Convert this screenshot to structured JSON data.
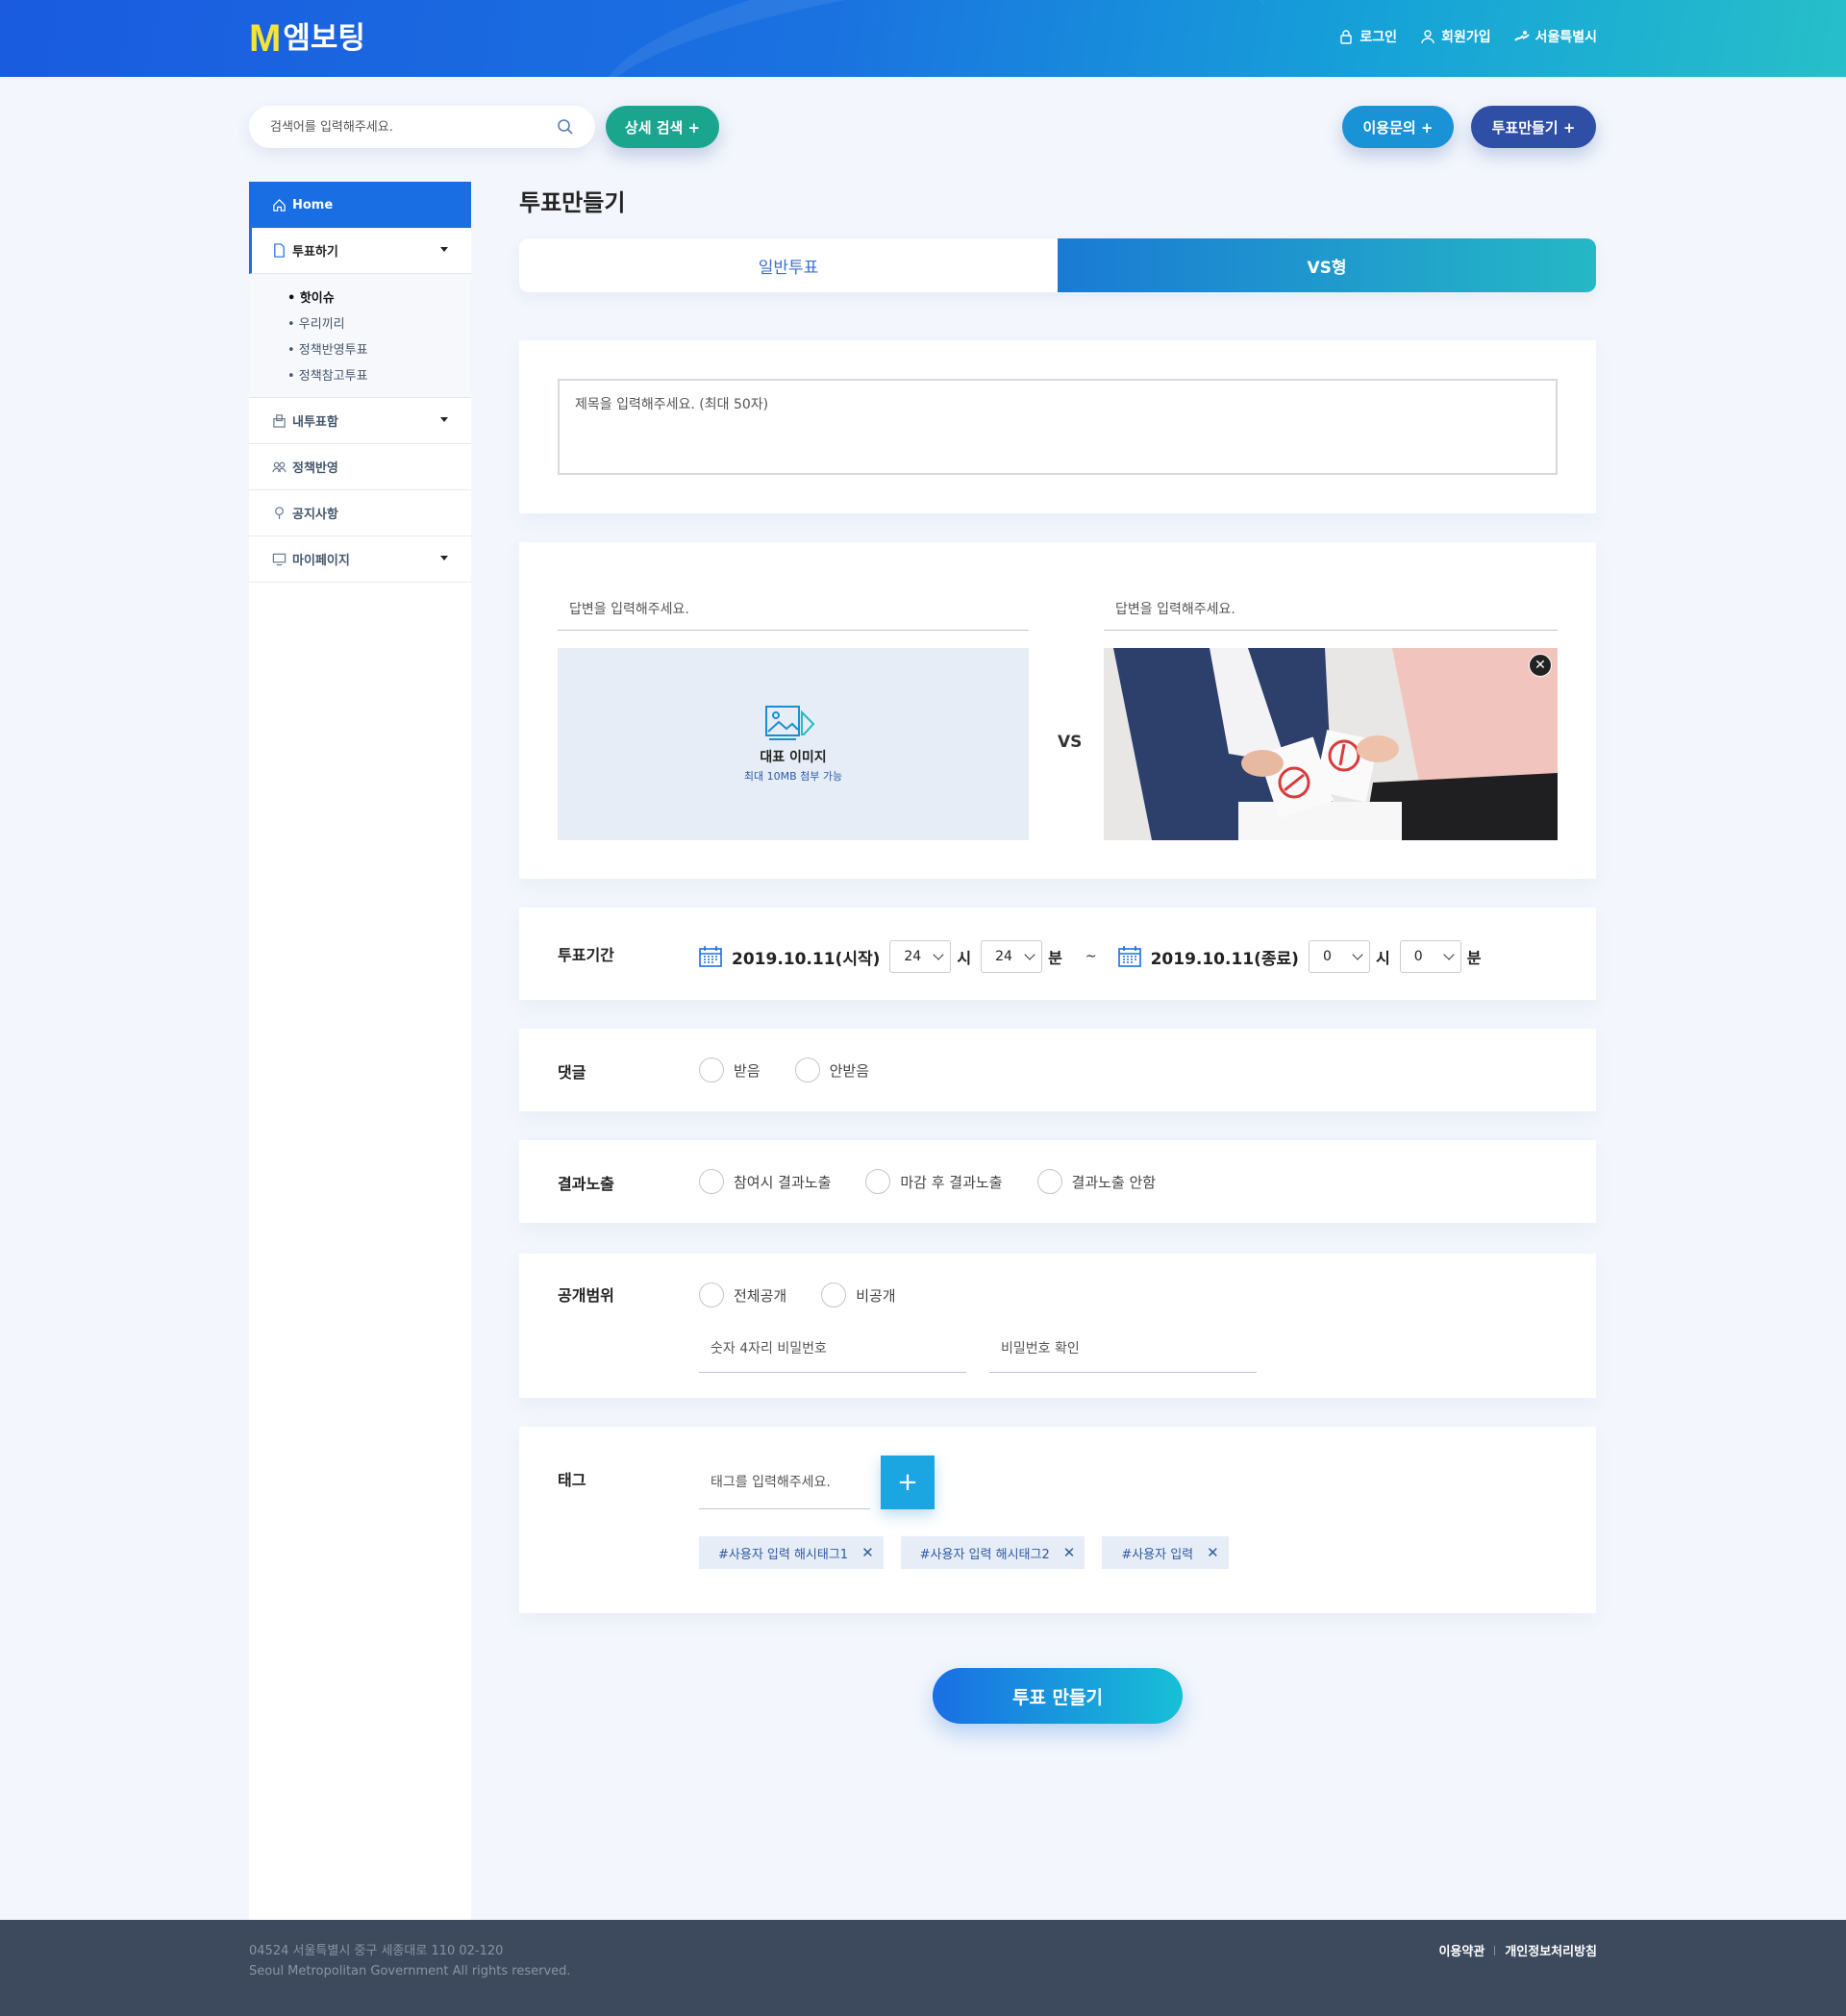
{
  "header": {
    "logo_mark": "M",
    "logo_text": "엠보팅",
    "links": [
      {
        "label": "로그인",
        "icon": "lock-icon"
      },
      {
        "label": "회원가입",
        "icon": "user-icon"
      },
      {
        "label": "서울특별시",
        "icon": "seoul-icon"
      }
    ]
  },
  "search": {
    "placeholder": "검색어를 입력해주세요.",
    "detail_button": "상세 검색 +"
  },
  "actions": {
    "inquiry": "이용문의 +",
    "create": "투표만들기 +"
  },
  "sidebar": {
    "items": [
      {
        "label": "Home"
      },
      {
        "label": "투표하기"
      },
      {
        "label": "내투표함"
      },
      {
        "label": "정책반영"
      },
      {
        "label": "공지사항"
      },
      {
        "label": "마이페이지"
      }
    ],
    "sub_items": [
      "• 핫이슈",
      "• 우리끼리",
      "• 정책반영투표",
      "• 정책참고투표"
    ]
  },
  "main": {
    "title": "투표만들기",
    "tabs": [
      {
        "label": "일반투표",
        "active": false
      },
      {
        "label": "VS형",
        "active": true
      }
    ],
    "title_placeholder": "제목을 입력해주세요. (최대 50자)",
    "answer_placeholder_left": "답변을 입력해주세요.",
    "answer_placeholder_right": "답변을 입력해주세요.",
    "image_label": "대표 이미지",
    "image_note": "최대 10MB 첨부 가능",
    "vs": "VS",
    "period": {
      "label": "투표기간",
      "start_date": "2019.10.11(시작)",
      "start_hour": "24",
      "start_min": "24",
      "end_date": "2019.10.11(종료)",
      "end_hour": "0",
      "end_min": "0",
      "hour_unit": "시",
      "min_unit": "분",
      "tilde": "~"
    },
    "comment": {
      "label": "댓글",
      "options": [
        "받음",
        "안받음"
      ]
    },
    "result": {
      "label": "결과노출",
      "options": [
        "참여시 결과노출",
        "마감 후 결과노출",
        "결과노출 안함"
      ]
    },
    "open": {
      "label": "공개범위",
      "options": [
        "전체공개",
        "비공개"
      ],
      "pw_placeholder": "숫자 4자리 비밀번호",
      "pw_confirm_placeholder": "비밀번호 확인"
    },
    "tag": {
      "label": "태그",
      "placeholder": "태그를 입력해주세요.",
      "add": "+",
      "items": [
        "#사용자 입력 해시태그1",
        "#사용자 입력 해시태그2",
        "#사용자 입력"
      ]
    },
    "submit": "투표 만들기"
  },
  "footer": {
    "address": "04524 서울특별시 중구 세종대로 110    02-120",
    "copyright": "Seoul Metropolitan Government All rights reserved.",
    "links": [
      "이용약관",
      "개인정보처리방침"
    ]
  },
  "colors": {
    "primary": "#1a6ee4",
    "accent_teal": "#1aa58f",
    "navy": "#2f4ea5",
    "footer": "#3d4a5e"
  }
}
